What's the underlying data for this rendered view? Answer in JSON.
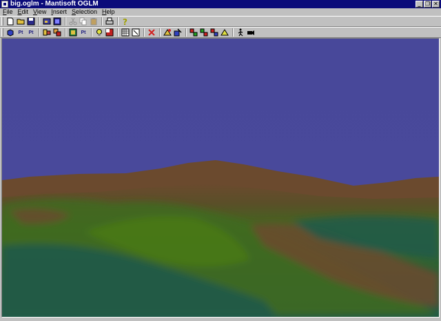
{
  "window": {
    "title": "big.oglm - Mantisoft OGLM",
    "minimize": "_",
    "restore": "❐",
    "close": "✕"
  },
  "menu": {
    "items": [
      {
        "key": "F",
        "rest": "ile"
      },
      {
        "key": "E",
        "rest": "dit"
      },
      {
        "key": "V",
        "rest": "iew"
      },
      {
        "key": "I",
        "rest": "nsert"
      },
      {
        "key": "S",
        "rest": "election"
      },
      {
        "key": "H",
        "rest": "elp"
      }
    ]
  },
  "toolbar1": {
    "icons": [
      "new-file-icon",
      "open-folder-icon",
      "save-disk-icon",
      "cut-scissors-icon",
      "copy-icon",
      "paste-icon",
      "print-icon",
      "help-icon"
    ]
  },
  "toolbar2": {
    "pt_label_1": "Pt",
    "pt_label_2": "Pt",
    "pt_label_3": "Pt"
  },
  "colors": {
    "sky": "#48489a",
    "title_bar": "#0b0b7a",
    "terrain_brown": "#6b4a2e",
    "terrain_green": "#3e6a1e",
    "terrain_teal": "#1f5a4a"
  }
}
